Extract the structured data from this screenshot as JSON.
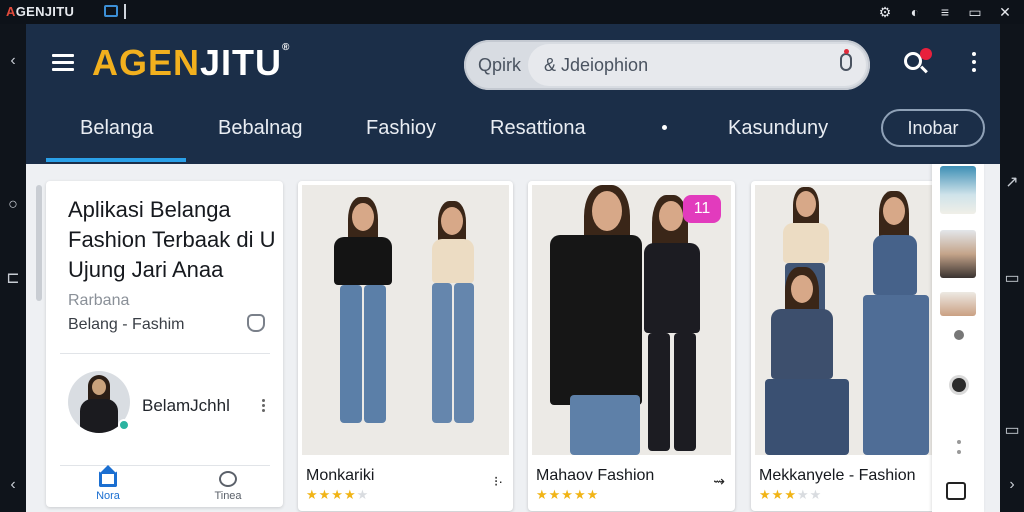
{
  "os": {
    "brand_a": "A",
    "brand_rest": "GENJITU",
    "tray": [
      "⚙",
      "◐",
      "≡",
      "▭",
      "✕"
    ]
  },
  "gutter": {
    "left_icons": [
      "‹",
      "○",
      "⊏",
      "‹"
    ],
    "right_icons": [
      "↗",
      "▭",
      "▭",
      "›"
    ]
  },
  "header": {
    "logo_yellow": "AGEN",
    "logo_white": "JITU",
    "search_prefix": "Qpirk",
    "search_placeholder": "& Jdeiophion",
    "tabs": [
      "Belanga",
      "Bebalnag",
      "Fashioy",
      "Resattiona",
      "Kasunduny"
    ],
    "tab_button": "Inobar",
    "active_tab_color": "#2aa0e8"
  },
  "promo": {
    "title": "Aplikasi Belanga Fashion Terbaak di U Ujung Jari Anaa",
    "subtitle": "Rarbana",
    "category": "Belang - Fashim",
    "store_name": "BelamJchhl",
    "nav_home": "Nora",
    "nav_chat": "Tinea"
  },
  "products": [
    {
      "name": "Monkariki",
      "rating": 3.5,
      "action": "⁝·"
    },
    {
      "name": "Mahaov Fashion",
      "rating": 4.5,
      "action": "⇝",
      "badge": "11"
    },
    {
      "name": "Mekkanyele - Fashion",
      "rating": 2.5,
      "action": ""
    }
  ],
  "colors": {
    "header_bg": "#1b2e48",
    "logo_yellow": "#f2b01e",
    "badge_pink": "#e23bbd",
    "star_gold": "#f1b416"
  }
}
